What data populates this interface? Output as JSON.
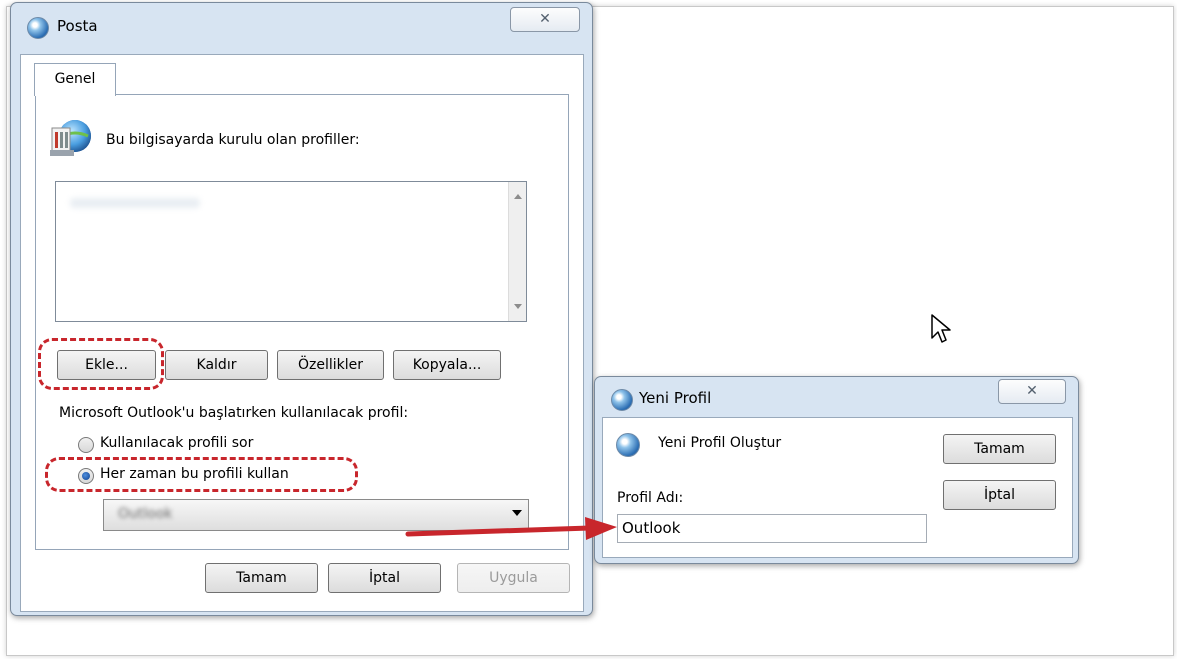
{
  "posta_dialog": {
    "title": "Posta",
    "close": "✕",
    "tab_label": "Genel",
    "profiles_heading": "Bu bilgisayarda kurulu olan profiller:",
    "profiles_list": [],
    "buttons": {
      "add": "Ekle...",
      "remove": "Kaldır",
      "properties": "Özellikler",
      "copy": "Kopyala..."
    },
    "startup_label": "Microsoft Outlook'u başlatırken kullanılacak profil:",
    "radio_prompt": "Kullanılacak profili sor",
    "radio_always": "Her zaman bu profili kullan",
    "selected_option": "radio_always",
    "profile_combo_value": "Outlook",
    "footer": {
      "ok": "Tamam",
      "cancel": "İptal",
      "apply": "Uygula"
    }
  },
  "new_profile_dialog": {
    "title": "Yeni Profil",
    "close": "✕",
    "heading": "Yeni Profil Oluştur",
    "ok": "Tamam",
    "cancel": "İptal",
    "name_label": "Profil Adı:",
    "name_value": "Outlook"
  },
  "annotations": {
    "highlight_color": "#c8262c",
    "arrow_color": "#c8262c"
  },
  "icons": [
    "mail-app-icon",
    "close-icon",
    "profiles-icon",
    "scroll-up-icon",
    "scroll-down-icon",
    "dropdown-arrow-icon",
    "mouse-cursor-icon",
    "annotation-arrow-icon"
  ]
}
